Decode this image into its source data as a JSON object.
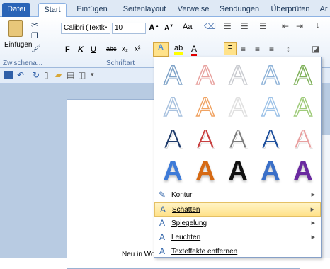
{
  "tabs": [
    "Datei",
    "Start",
    "Einfügen",
    "Seitenlayout",
    "Verweise",
    "Sendungen",
    "Überprüfen",
    "Ar"
  ],
  "ribbon": {
    "paste_label": "Einfügen",
    "font_name": "Calibri (Textk•",
    "font_size": "10",
    "group_clipboard": "Zwischena...",
    "group_font": "Schriftart"
  },
  "gallery": {
    "rows": [
      {
        "style": "outline-blue"
      },
      {
        "style": "outline-light"
      },
      {
        "style": "metallic"
      },
      {
        "style": "solid"
      }
    ],
    "colors": [
      [
        "#7fa3c8",
        "#e8a3a0",
        "#c9cbd0",
        "#8fb3d8",
        "#7fb15a"
      ],
      [
        "#a9c2df",
        "#f0a464",
        "#e0e0e0",
        "#9ec3e8",
        "#9fcb7a"
      ],
      [
        "#1e3a6a",
        "#c84040",
        "#7d7d7d",
        "#1e4f9c",
        "#e8a0a0"
      ],
      [
        "#3e7bd8",
        "#d66a14",
        "#111111",
        "#3a6fc8",
        "#6a2aa0"
      ]
    ]
  },
  "menu": [
    {
      "label": "Kontur",
      "icon": "pen-icon",
      "hl": false
    },
    {
      "label": "Schatten",
      "icon": "shadow-icon",
      "hl": true
    },
    {
      "label": "Spiegelung",
      "icon": "reflection-icon",
      "hl": false
    },
    {
      "label": "Leuchten",
      "icon": "glow-icon",
      "hl": false
    },
    {
      "label": "Texteffekte entfernen",
      "icon": "clear-effects-icon",
      "hl": false
    }
  ],
  "doc_text": "Neu in Wo"
}
